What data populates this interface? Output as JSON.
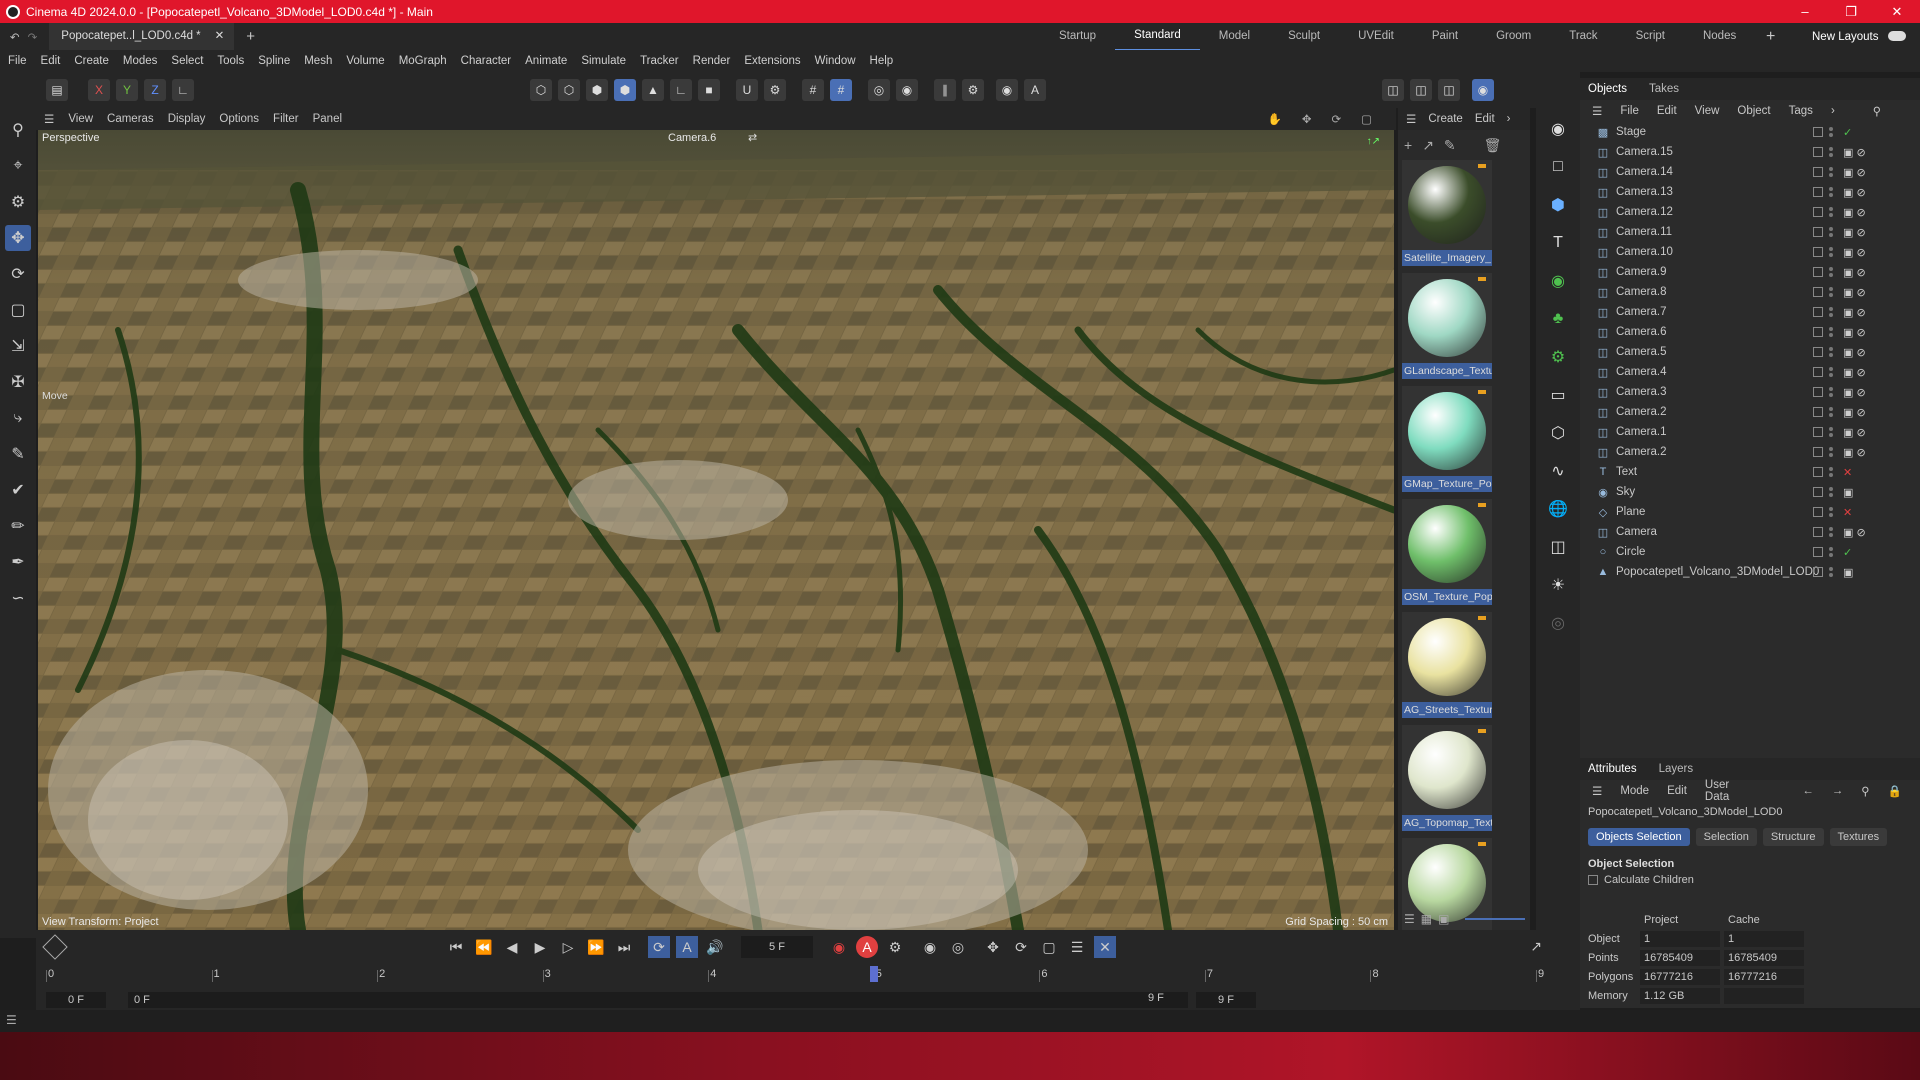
{
  "title_bar": {
    "title": "Cinema 4D 2024.0.0 - [Popocatepetl_Volcano_3DModel_LOD0.c4d *] - Main"
  },
  "file_tab": {
    "label": "Popocatepetl_Volcano_3DModel_LOD0.c4d *",
    "short": "Popocatepet..l_LOD0.c4d *"
  },
  "layouts": [
    "Startup",
    "Standard",
    "Model",
    "Sculpt",
    "UVEdit",
    "Paint",
    "Groom",
    "Track",
    "Script",
    "Nodes"
  ],
  "layouts_active": "Standard",
  "new_layouts": "New Layouts",
  "menu": [
    "File",
    "Edit",
    "Create",
    "Modes",
    "Select",
    "Tools",
    "Spline",
    "Mesh",
    "Volume",
    "MoGraph",
    "Character",
    "Animate",
    "Simulate",
    "Tracker",
    "Render",
    "Extensions",
    "Window",
    "Help"
  ],
  "axis_buttons": [
    "X",
    "Y",
    "Z"
  ],
  "viewport_menu": [
    "View",
    "Cameras",
    "Display",
    "Options",
    "Filter",
    "Panel"
  ],
  "viewport": {
    "projection": "Perspective",
    "camera": "Camera.6",
    "tool_label": "Move",
    "view_transform": "View Transform: Project",
    "grid_spacing": "Grid Spacing : 50 cm"
  },
  "material_menu": [
    "Create",
    "Edit"
  ],
  "materials": [
    {
      "label": "Satellite_Imagery_",
      "color": "#3b4d2a"
    },
    {
      "label": "GLandscape_Textu",
      "color": "#9fd8c4"
    },
    {
      "label": "GMap_Texture_Po",
      "color": "#7fdcbf"
    },
    {
      "label": "OSM_Texture_Pop",
      "color": "#6fbf6a"
    },
    {
      "label": "AG_Streets_Textur",
      "color": "#e9e2a0"
    },
    {
      "label": "AG_Topomap_Text",
      "color": "#dfe6cc"
    },
    {
      "label": "",
      "color": "#b8d8a0"
    }
  ],
  "objects_panel": {
    "tabs": [
      "Objects",
      "Takes"
    ],
    "menu": [
      "File",
      "Edit",
      "View",
      "Object",
      "Tags"
    ],
    "items": [
      "Stage",
      "Camera.15",
      "Camera.14",
      "Camera.13",
      "Camera.12",
      "Camera.11",
      "Camera.10",
      "Camera.9",
      "Camera.8",
      "Camera.7",
      "Camera.6",
      "Camera.5",
      "Camera.4",
      "Camera.3",
      "Camera.2",
      "Camera.1",
      "Camera.2",
      "Text",
      "Sky",
      "Plane",
      "Camera",
      "Circle",
      "Popocatepetl_Volcano_3DModel_LOD0"
    ]
  },
  "attributes_panel": {
    "tabs": [
      "Attributes",
      "Layers"
    ],
    "menu": [
      "Mode",
      "Edit",
      "User Data"
    ],
    "object_name": "Popocatepetl_Volcano_3DModel_LOD0",
    "buttons": [
      "Objects Selection",
      "Selection",
      "Structure",
      "Textures"
    ],
    "section": "Object Selection",
    "calc_children": "Calculate Children",
    "col_project": "Project",
    "col_cache": "Cache",
    "rows": [
      {
        "label": "Object",
        "project": "1",
        "cache": "1"
      },
      {
        "label": "Points",
        "project": "16785409",
        "cache": "16785409"
      },
      {
        "label": "Polygons",
        "project": "16777216",
        "cache": "16777216"
      },
      {
        "label": "Memory",
        "project": "1.12 GB",
        "cache": ""
      }
    ]
  },
  "timeline": {
    "current_frame": "5 F",
    "ticks": [
      "0",
      "1",
      "2",
      "3",
      "4",
      "5",
      "6",
      "7",
      "8",
      "9"
    ],
    "start": "0 F",
    "start2": "0 F",
    "end": "9 F",
    "end2": "9 F",
    "playhead_frame": 5
  },
  "colors": {
    "accent": "#3d5f9d",
    "title_bar": "#e0162b",
    "checkmark": "#4fc14f",
    "red_x": "#e04040"
  }
}
